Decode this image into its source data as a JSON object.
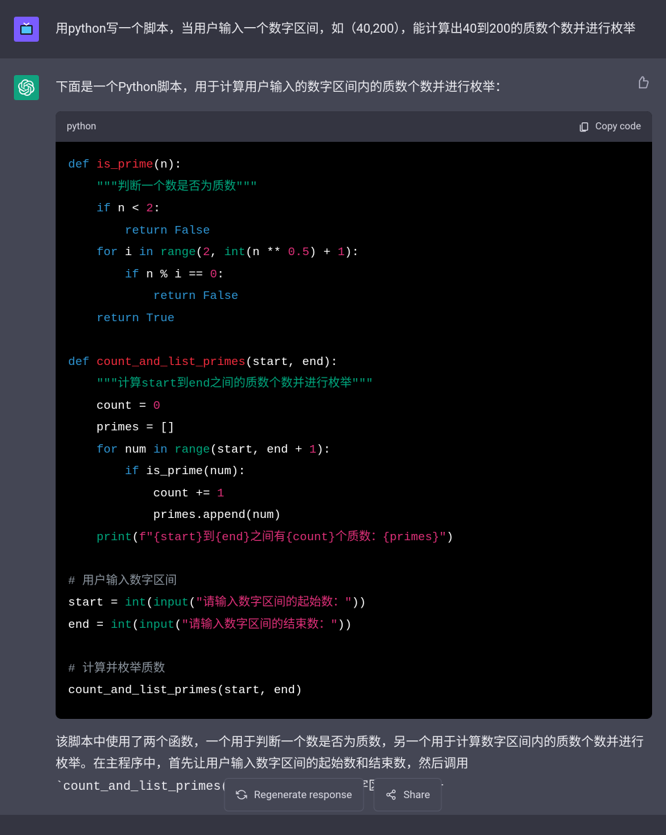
{
  "user": {
    "prompt": "用python写一个脚本，当用户输入一个数字区间，如（40,200），能计算出40到200的质数个数并进行枚举"
  },
  "assistant": {
    "intro": "下面是一个Python脚本，用于计算用户输入的数字区间内的质数个数并进行枚举：",
    "explain_part1": "该脚本中使用了两个函数，一个用于判断一个数是否为质数，另一个用于计算数字区间内的质数个数并进行枚举。在主程序中，首先让用户输入数字区间的起始数和结束数，然后调用",
    "explain_fn": "`count_and_list_primes()`",
    "explain_part2": "函数，该函数遍历数字区间内的每一"
  },
  "code": {
    "lang": "python",
    "copy_label": "Copy code",
    "src": {
      "l1_def": "def",
      "l1_fn": "is_prime",
      "l1_rest": "(n):",
      "l2_doc": "\"\"\"判断一个数是否为质数\"\"\"",
      "l3_if": "if",
      "l3_rest": " n < ",
      "l3_two": "2",
      "l3_colon": ":",
      "l4_ret": "return",
      "l4_false": " False",
      "l5_for": "for",
      "l5_i": " i ",
      "l5_in": "in",
      "l5_sp": " ",
      "l5_range": "range",
      "l5_open": "(",
      "l5_2": "2",
      "l5_c1": ", ",
      "l5_int": "int",
      "l5_open2": "(n ** ",
      "l5_05": "0.5",
      "l5_close1": ") + ",
      "l5_1": "1",
      "l5_close2": "):",
      "l6_if": "if",
      "l6_rest": " n % i == ",
      "l6_0": "0",
      "l6_colon": ":",
      "l7_ret": "return",
      "l7_false": " False",
      "l8_ret": "return",
      "l8_true": " True",
      "l10_def": "def",
      "l10_fn": "count_and_list_primes",
      "l10_rest": "(start, end):",
      "l11_doc": "\"\"\"计算start到end之间的质数个数并进行枚举\"\"\"",
      "l12_lhs": "    count = ",
      "l12_0": "0",
      "l13": "    primes = []",
      "l14_for": "for",
      "l14_num": " num ",
      "l14_in": "in",
      "l14_sp": " ",
      "l14_range": "range",
      "l14_open": "(start, end + ",
      "l14_1": "1",
      "l14_close": "):",
      "l15_if": "if",
      "l15_rest": " is_prime(num):",
      "l16_lhs": "            count += ",
      "l16_1": "1",
      "l17": "            primes.append(num)",
      "l18_print": "print",
      "l18_open": "(",
      "l18_f": "f\"{start}到{end}之间有{count}个质数：{primes}\"",
      "l18_close": ")",
      "l20_cm": "# 用户输入数字区间",
      "l21_lhs": "start = ",
      "l21_int": "int",
      "l21_open": "(",
      "l21_input": "input",
      "l21_open2": "(",
      "l21_str": "\"请输入数字区间的起始数：\"",
      "l21_close": "))",
      "l22_lhs": "end = ",
      "l22_int": "int",
      "l22_open": "(",
      "l22_input": "input",
      "l22_open2": "(",
      "l22_str": "\"请输入数字区间的结束数：\"",
      "l22_close": "))",
      "l24_cm": "# 计算并枚举质数",
      "l25": "count_and_list_primes(start, end)"
    }
  },
  "buttons": {
    "regen": "Regenerate response",
    "share": "Share"
  }
}
